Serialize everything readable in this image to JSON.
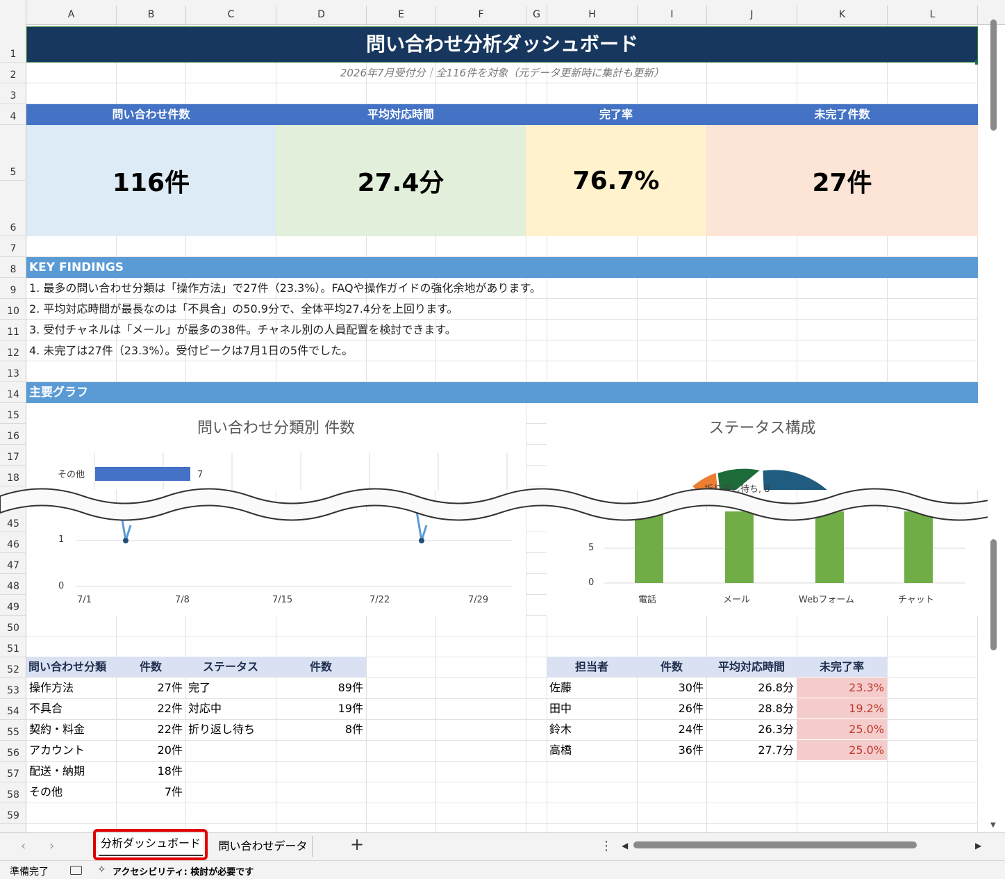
{
  "columns": [
    "A",
    "B",
    "C",
    "D",
    "E",
    "F",
    "G",
    "H",
    "I",
    "J",
    "K",
    "L"
  ],
  "rows_top": [
    "1",
    "2",
    "3",
    "4",
    "5",
    "6",
    "7",
    "8",
    "9",
    "10",
    "11",
    "12",
    "13",
    "14",
    "15",
    "16",
    "17",
    "18"
  ],
  "rows_bottom": [
    "45",
    "46",
    "47",
    "48",
    "49",
    "50",
    "51",
    "52",
    "53",
    "54",
    "55",
    "56",
    "57",
    "58",
    "59"
  ],
  "title": "問い合わせ分析ダッシュボード",
  "subtitle": "2026年7月受付分｜全116件を対象（元データ更新時に集計も更新）",
  "kpis": [
    {
      "label": "問い合わせ件数",
      "value": "116件",
      "color": "#ddebf7"
    },
    {
      "label": "平均対応時間",
      "value": "27.4分",
      "color": "#e2efda"
    },
    {
      "label": "完了率",
      "value": "76.7%",
      "color": "#fff2cc"
    },
    {
      "label": "未完了件数",
      "value": "27件",
      "color": "#fce4d6"
    }
  ],
  "findings_header": "KEY FINDINGS",
  "findings": [
    "1. 最多の問い合わせ分類は「操作方法」で27件（23.3%）。FAQや操作ガイドの強化余地があります。",
    "2. 平均対応時間が最長なのは「不具合」の50.9分で、全体平均27.4分を上回ります。",
    "3. 受付チャネルは「メール」が最多の38件。チャネル別の人員配置を検討できます。",
    "4. 未完了は27件（23.3%）。受付ピークは7月1日の5件でした。"
  ],
  "graphs_header": "主要グラフ",
  "chart_data": [
    {
      "type": "bar",
      "title": "問い合わせ分類別 件数",
      "categories": [
        "その他"
      ],
      "values": [
        7
      ]
    },
    {
      "type": "pie",
      "title": "ステータス構成",
      "labels": [
        "折り返し待ち, 8"
      ]
    },
    {
      "type": "line",
      "x": [
        "7/1",
        "7/8",
        "7/15",
        "7/22",
        "7/29"
      ],
      "y_ticks": [
        "0",
        "1"
      ]
    },
    {
      "type": "bar",
      "categories": [
        "電話",
        "メール",
        "Webフォーム",
        "チャット"
      ],
      "y_ticks": [
        "0",
        "5"
      ]
    }
  ],
  "table1": {
    "headers": [
      "問い合わせ分類",
      "件数"
    ],
    "rows": [
      [
        "操作方法",
        "27件"
      ],
      [
        "不具合",
        "22件"
      ],
      [
        "契約・料金",
        "22件"
      ],
      [
        "アカウント",
        "20件"
      ],
      [
        "配送・納期",
        "18件"
      ],
      [
        "その他",
        "7件"
      ]
    ]
  },
  "table2": {
    "headers": [
      "ステータス",
      "件数"
    ],
    "rows": [
      [
        "完了",
        "89件"
      ],
      [
        "対応中",
        "19件"
      ],
      [
        "折り返し待ち",
        "8件"
      ]
    ]
  },
  "table3": {
    "headers": [
      "担当者",
      "件数",
      "平均対応時間",
      "未完了率"
    ],
    "rows": [
      [
        "佐藤",
        "30件",
        "26.8分",
        "23.3%"
      ],
      [
        "田中",
        "26件",
        "28.8分",
        "19.2%"
      ],
      [
        "鈴木",
        "24件",
        "26.3分",
        "25.0%"
      ],
      [
        "高橋",
        "36件",
        "27.7分",
        "25.0%"
      ]
    ]
  },
  "sheets": {
    "active": "分析ダッシュボード",
    "other": "問い合わせデータ",
    "add": "+",
    "more": "⋮"
  },
  "status": {
    "ready": "準備完了",
    "accessibility": "アクセシビリティ: 検討が必要です"
  },
  "colors": {
    "navy": "#17375e",
    "blue_header": "#4472c4",
    "section_blue": "#5b9bd5",
    "bar_blue": "#4472c4",
    "green_bar": "#70ad47",
    "line_blue": "#5b9bd5",
    "pink": "#f4cccc",
    "red_text": "#c0392b",
    "orange": "#ed7d31",
    "dark_green": "#1e6b3a",
    "teal": "#1f5c80",
    "highlight_red": "#e00000"
  },
  "icons": [
    "chevron-left-icon",
    "chevron-right-icon",
    "scroll-left-icon",
    "scroll-right-icon",
    "macro-record-icon",
    "accessibility-icon",
    "scroll-up-icon",
    "scroll-down-icon"
  ]
}
